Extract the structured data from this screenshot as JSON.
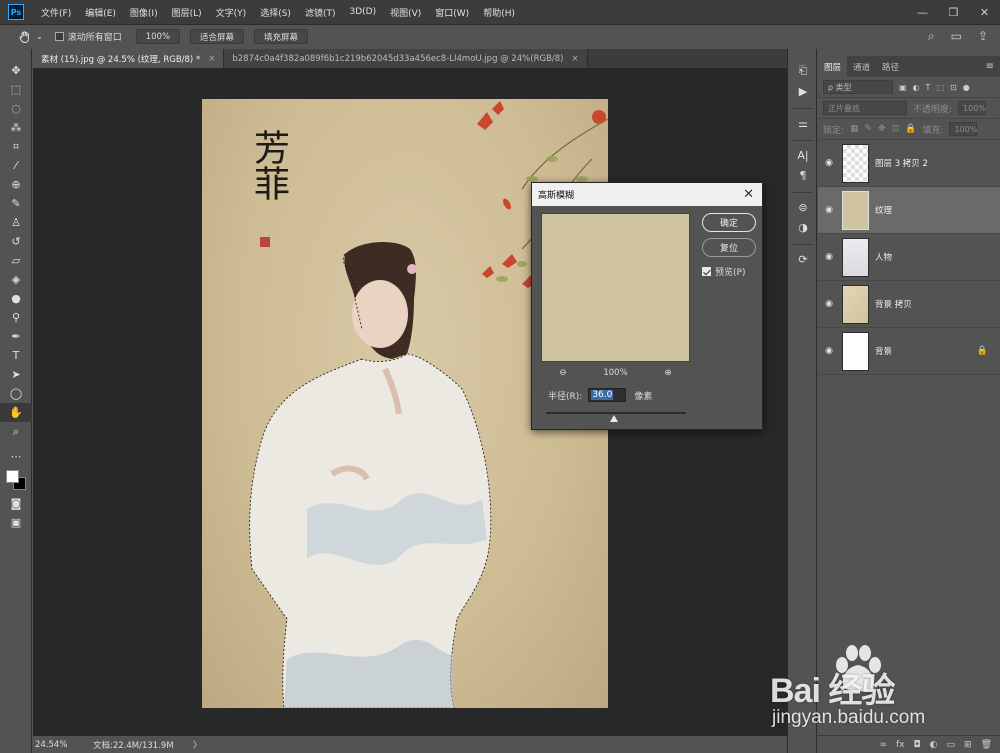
{
  "app": {
    "logo": "Ps",
    "menu": [
      "文件(F)",
      "编辑(E)",
      "图像(I)",
      "图层(L)",
      "文字(Y)",
      "选择(S)",
      "滤镜(T)",
      "3D(D)",
      "视图(V)",
      "窗口(W)",
      "帮助(H)"
    ],
    "window_controls": [
      "—",
      "❐",
      "✕"
    ]
  },
  "options_bar": {
    "tool_icon": "hand-icon",
    "scroll_all_windows_label": "滚动所有窗口",
    "scroll_all_windows_checked": false,
    "zoom_button": "100%",
    "fit_screen_button": "适合屏幕",
    "fill_screen_button": "填充屏幕"
  },
  "tabs": [
    {
      "title": "素材 (15).jpg @ 24.5% (纹理, RGB/8) *",
      "active": true,
      "close": "×"
    },
    {
      "title": "b2874c0a4f382a089f6b1c219b62045d33a456ec8-LI4moU.jpg @ 24%(RGB/8)",
      "active": false,
      "close": "×"
    }
  ],
  "status": {
    "zoom": "24.54%",
    "doc_info": "文档:22.4M/131.9M",
    "arrow": "〉"
  },
  "artwork": {
    "calligraphy": "芳菲"
  },
  "dialog": {
    "title": "高斯模糊",
    "close": "✕",
    "ok_button": "确定",
    "reset_button": "复位",
    "preview_label": "预览(P)",
    "preview_checked": true,
    "zoom_out": "⊖",
    "zoom_level": "100%",
    "zoom_in": "⊕",
    "radius_label": "半径(R):",
    "radius_value": "36.0",
    "radius_unit": "像素",
    "preview_color": "#cfc49f"
  },
  "layers_panel": {
    "tabs": [
      "图层",
      "通道",
      "路径"
    ],
    "active_tab": "图层",
    "filter_placeholder": "ρ 类型",
    "blend_mode": "正片叠底",
    "opacity_label": "不透明度:",
    "opacity_value": "100%",
    "lock_label": "锁定:",
    "fill_label": "填充:",
    "fill_value": "100%",
    "layers": [
      {
        "name": "图层 3 拷贝 2",
        "selected": false,
        "locked": false,
        "thumb": "#e8e8e8"
      },
      {
        "name": "纹理",
        "selected": true,
        "locked": false,
        "thumb": "#cfc49f"
      },
      {
        "name": "人物",
        "selected": false,
        "locked": false,
        "thumb": "#ecebee"
      },
      {
        "name": "背景 拷贝",
        "selected": false,
        "locked": false,
        "thumb": "#ddcfae"
      },
      {
        "name": "背景",
        "selected": false,
        "locked": true,
        "thumb": "#ffffff"
      }
    ],
    "footer_icons": [
      "∞",
      "fx",
      "◘",
      "◐",
      "▭",
      "⊞",
      "🗑"
    ]
  },
  "watermark": {
    "brand": "Bai 经验",
    "url": "jingyan.baidu.com"
  },
  "colors": {
    "accent": "#31a8ff",
    "paper": "#cdbb93",
    "selected_layer": "#6a6a6a"
  }
}
